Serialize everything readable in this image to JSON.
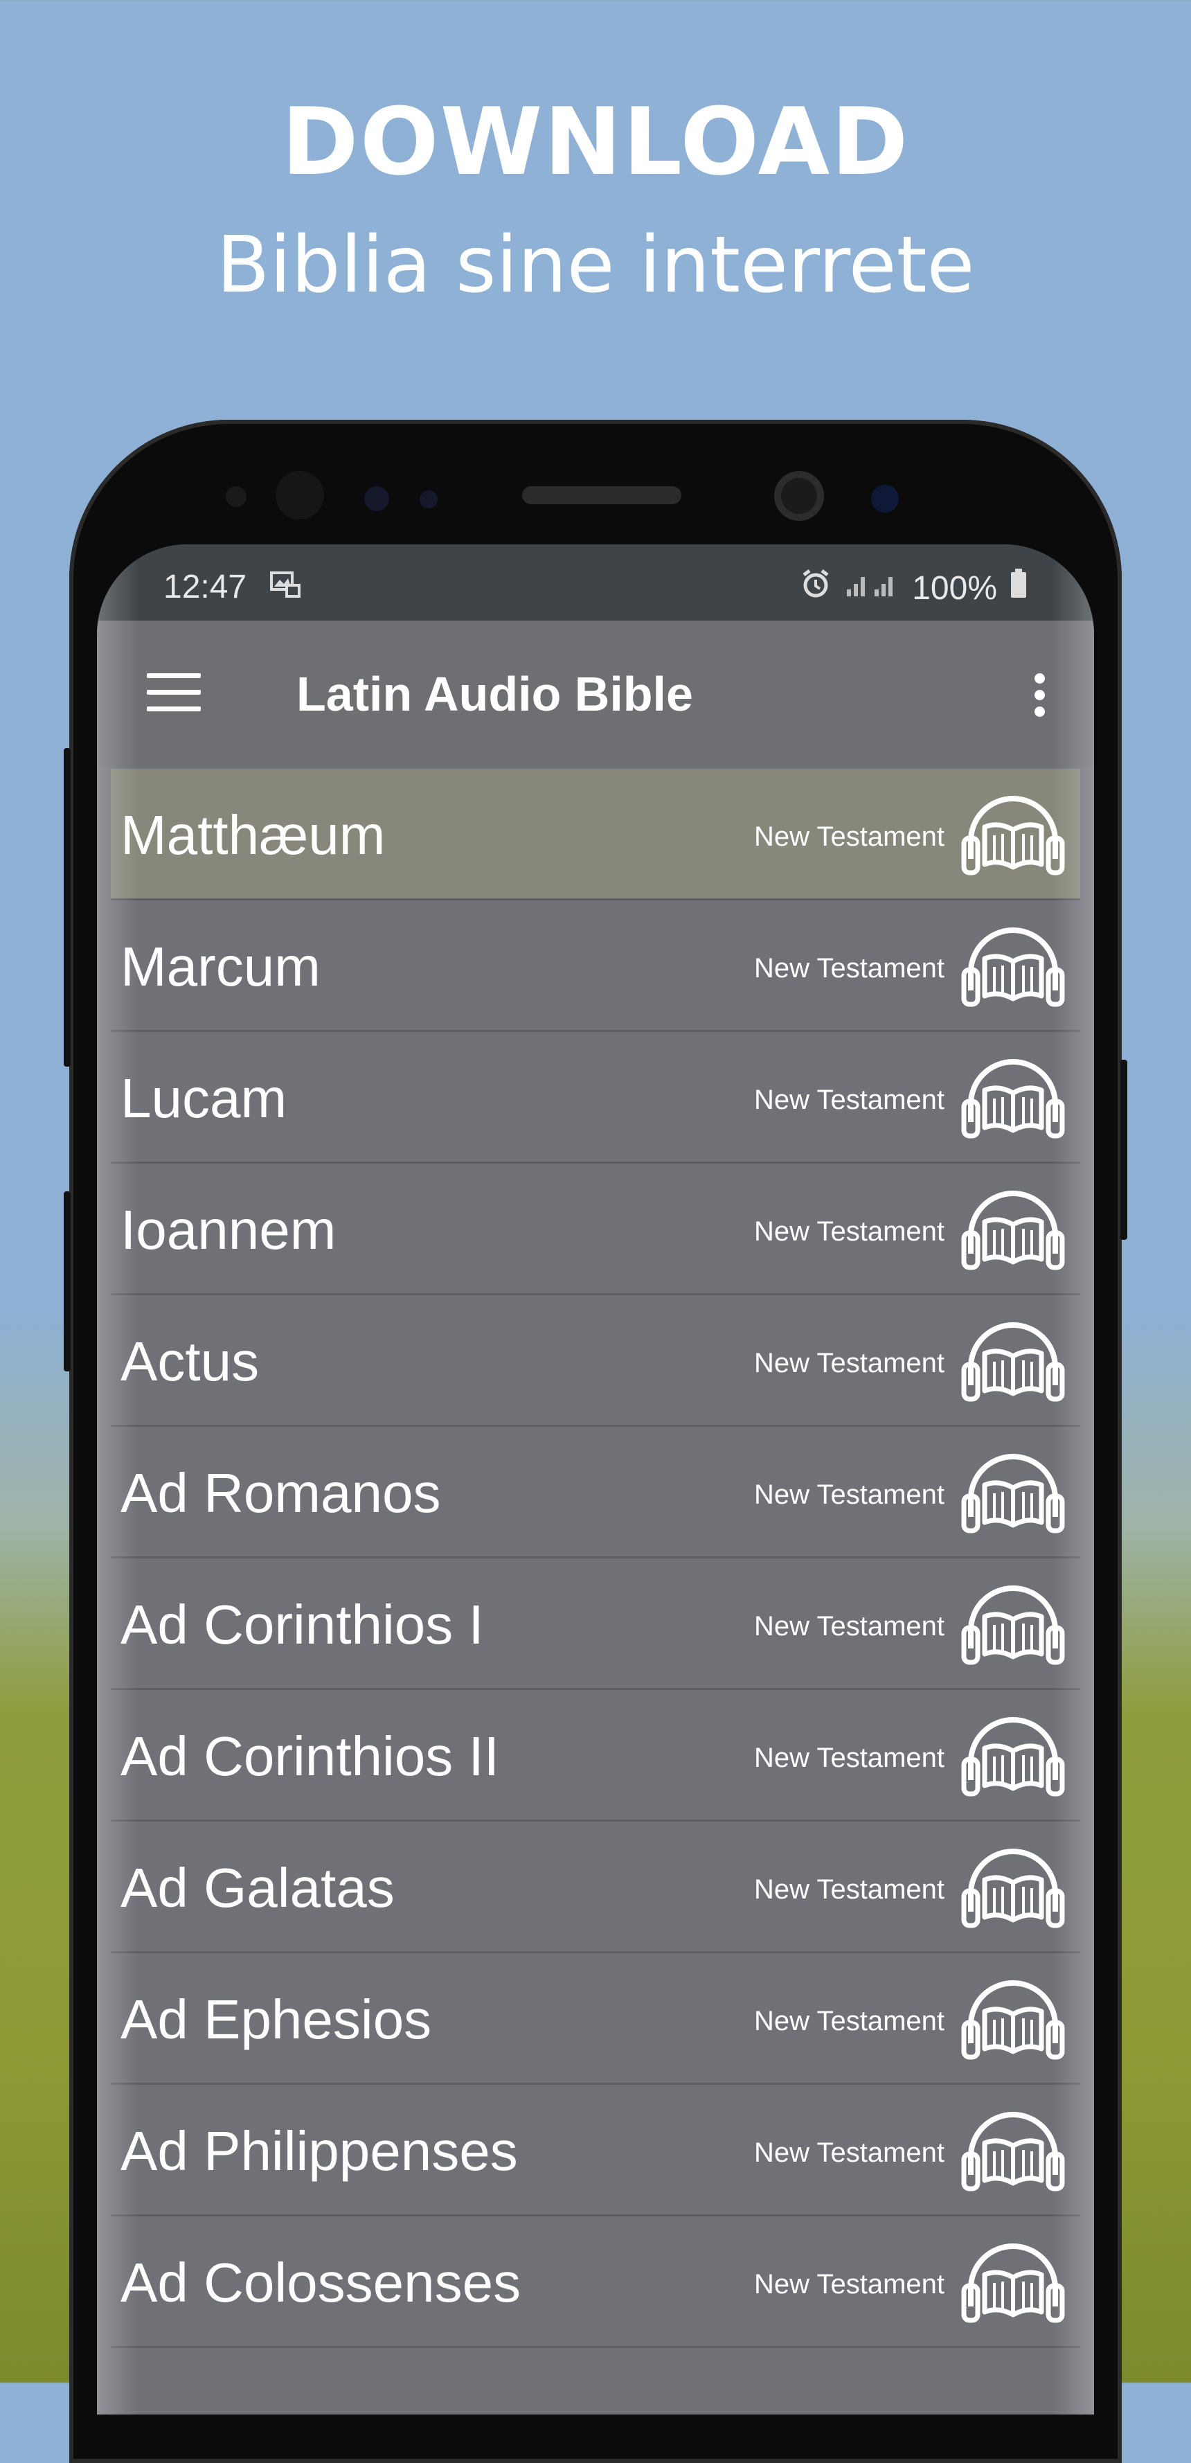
{
  "promo": {
    "headline": "DOWNLOAD",
    "subline": "Biblia sine interrete"
  },
  "status_bar": {
    "time": "12:47",
    "battery": "100%"
  },
  "app_bar": {
    "title": "Latin Audio Bible",
    "menu_icon": "hamburger-menu-icon",
    "overflow_icon": "more-vertical-icon"
  },
  "books": [
    {
      "name": "Matthæum",
      "testament": "New Testament",
      "selected": true
    },
    {
      "name": "Marcum",
      "testament": "New Testament"
    },
    {
      "name": "Lucam",
      "testament": "New Testament"
    },
    {
      "name": "Ioannem",
      "testament": "New Testament"
    },
    {
      "name": "Actus",
      "testament": "New Testament"
    },
    {
      "name": "Ad Romanos",
      "testament": "New Testament"
    },
    {
      "name": "Ad Corinthios I",
      "testament": "New Testament"
    },
    {
      "name": "Ad Corinthios II",
      "testament": "New Testament"
    },
    {
      "name": "Ad Galatas",
      "testament": "New Testament"
    },
    {
      "name": "Ad Ephesios",
      "testament": "New Testament"
    },
    {
      "name": "Ad Philippenses",
      "testament": "New Testament"
    },
    {
      "name": "Ad Colossenses",
      "testament": "New Testament"
    }
  ],
  "colors": {
    "app_bar": "#6d6f73",
    "list_background": "#6f7177",
    "selected_row": "#87887b",
    "status_bar": "#3e4448"
  }
}
